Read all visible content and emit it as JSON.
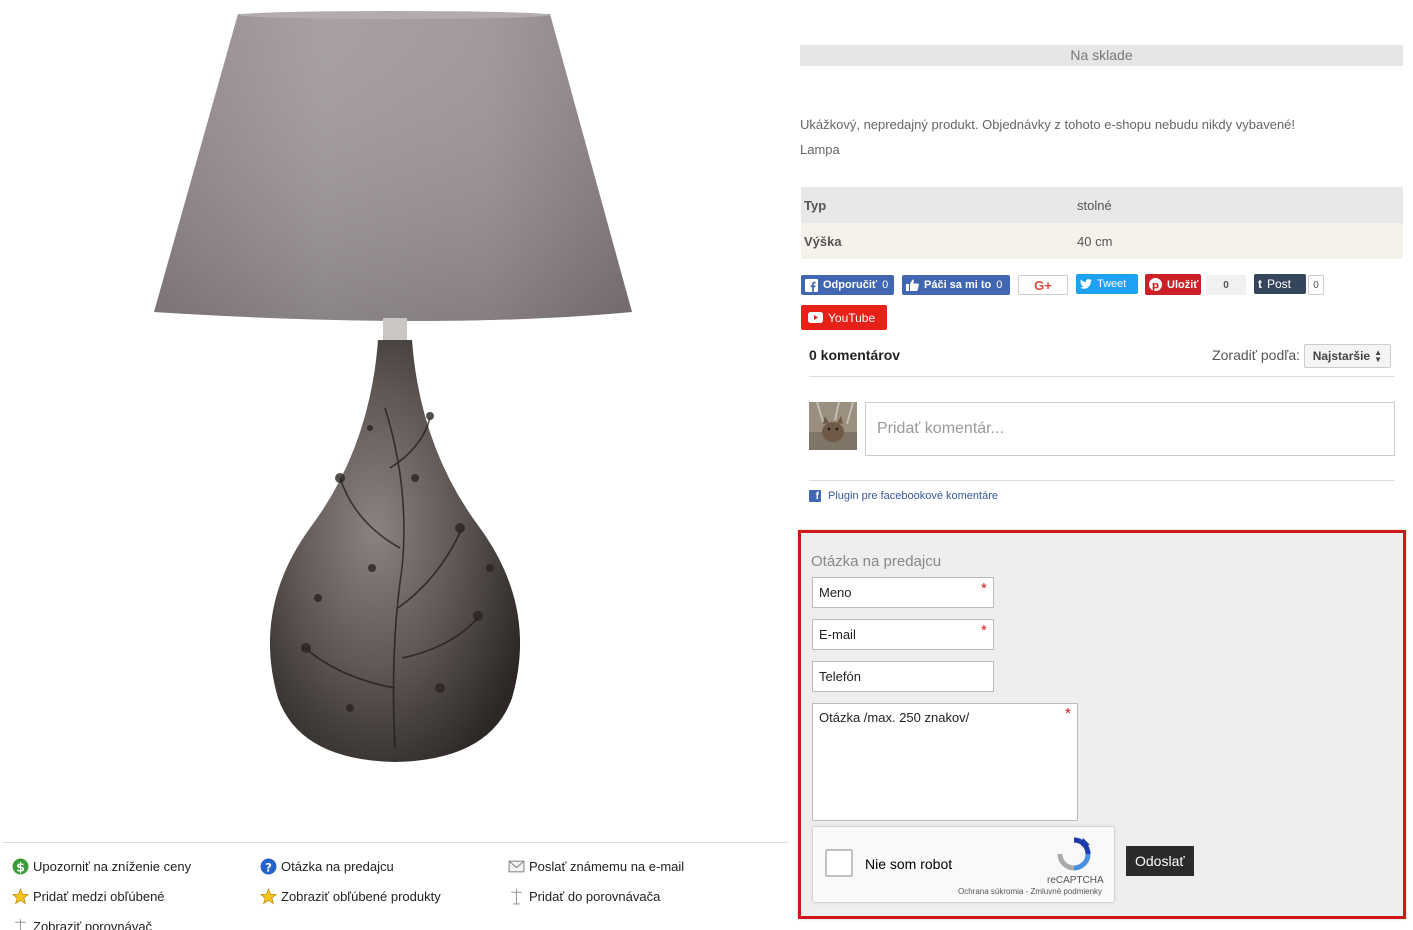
{
  "stock_status": "Na sklade",
  "description": {
    "note": "Ukážkový, nepredajný produkt. Objednávky z tohoto e-shopu nebudu nikdy vybavené!",
    "category": "Lampa"
  },
  "params": [
    {
      "name": "Typ",
      "value": "stolné"
    },
    {
      "name": "Výška",
      "value": "40 cm"
    }
  ],
  "social": {
    "fb_recommend": "Odporučiť",
    "fb_recommend_count": "0",
    "fb_like": "Páči sa mi to",
    "fb_like_count": "0",
    "gplus": "G+",
    "tweet": "Tweet",
    "pin": "Uložiť",
    "pin_count": "0",
    "tumblr": "Post",
    "tumblr_count": "0",
    "youtube": "YouTube"
  },
  "comments": {
    "count_label": "0 komentárov",
    "sort_label": "Zoradiť podľa:",
    "sort_value": "Najstaršie",
    "input_placeholder": "Pridať komentár...",
    "plugin_label": "Plugin pre facebookové komentáre"
  },
  "question_form": {
    "title": "Otázka na predajcu",
    "name_placeholder": "Meno",
    "email_placeholder": "E-mail",
    "phone_placeholder": "Telefón",
    "message_placeholder": "Otázka /max. 250 znakov/",
    "required_mark": "*",
    "captcha_label": "Nie som robot",
    "captcha_brand": "reCAPTCHA",
    "captcha_terms": "Ochrana súkromia - Zmluvné podmienky",
    "submit": "Odoslať"
  },
  "actions": [
    {
      "label": "Upozorniť na zníženie ceny",
      "icon": "dollar-icon"
    },
    {
      "label": "Otázka na predajcu",
      "icon": "question-icon"
    },
    {
      "label": "Poslať známemu na e-mail",
      "icon": "envelope-icon"
    },
    {
      "label": "Pridať medzi obľúbené",
      "icon": "star-icon"
    },
    {
      "label": "Zobraziť obľúbené produkty",
      "icon": "star-icon"
    },
    {
      "label": "Pridať do porovnávača",
      "icon": "scales-icon"
    },
    {
      "label": "Zobraziť porovnávač",
      "icon": "scales-icon"
    }
  ],
  "colors": {
    "accent_red": "#d0161a",
    "facebook": "#4267b2",
    "twitter": "#1da1f2",
    "pinterest": "#cb2027",
    "youtube": "#e62117"
  }
}
